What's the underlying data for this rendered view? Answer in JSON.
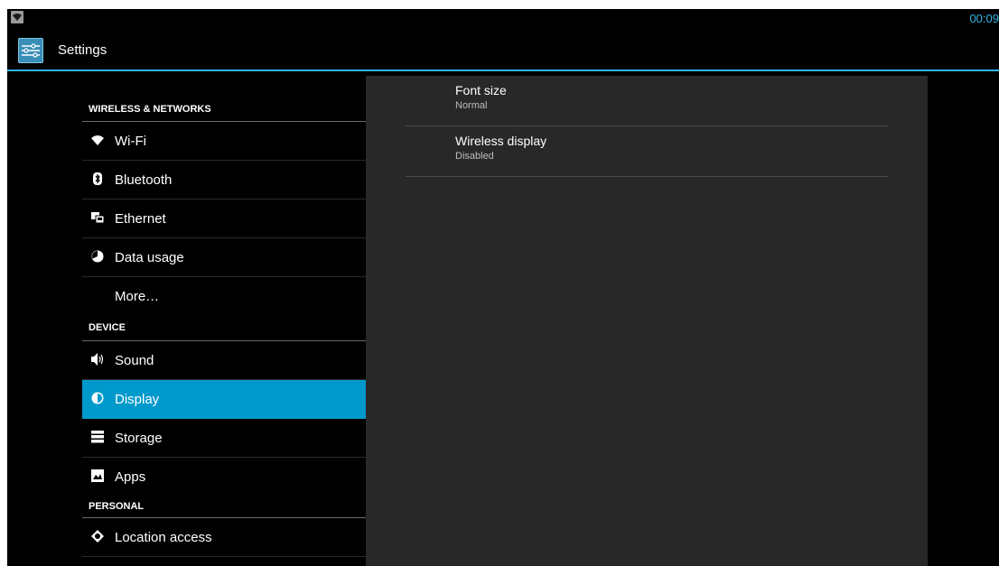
{
  "status_bar": {
    "time": "00:09",
    "accent_color": "#33b5e5"
  },
  "action_bar": {
    "title": "Settings",
    "icon": "settings-sliders-icon"
  },
  "nav": {
    "headers": {
      "wireless": "WIRELESS & NETWORKS",
      "device": "DEVICE",
      "personal": "PERSONAL"
    },
    "items": [
      {
        "label": "Wi-Fi",
        "icon": "wifi-icon"
      },
      {
        "label": "Bluetooth",
        "icon": "bluetooth-icon"
      },
      {
        "label": "Ethernet",
        "icon": "ethernet-icon"
      },
      {
        "label": "Data usage",
        "icon": "data-usage-icon"
      },
      {
        "label": "More…",
        "icon": ""
      },
      {
        "label": "Sound",
        "icon": "sound-icon"
      },
      {
        "label": "Display",
        "icon": "display-icon",
        "selected": true
      },
      {
        "label": "Storage",
        "icon": "storage-icon"
      },
      {
        "label": "Apps",
        "icon": "apps-icon"
      },
      {
        "label": "Location access",
        "icon": "location-icon"
      }
    ],
    "selected_color": "#0099cc"
  },
  "detail": {
    "prefs": [
      {
        "title": "Font size",
        "summary": "Normal"
      },
      {
        "title": "Wireless display",
        "summary": "Disabled"
      }
    ]
  }
}
